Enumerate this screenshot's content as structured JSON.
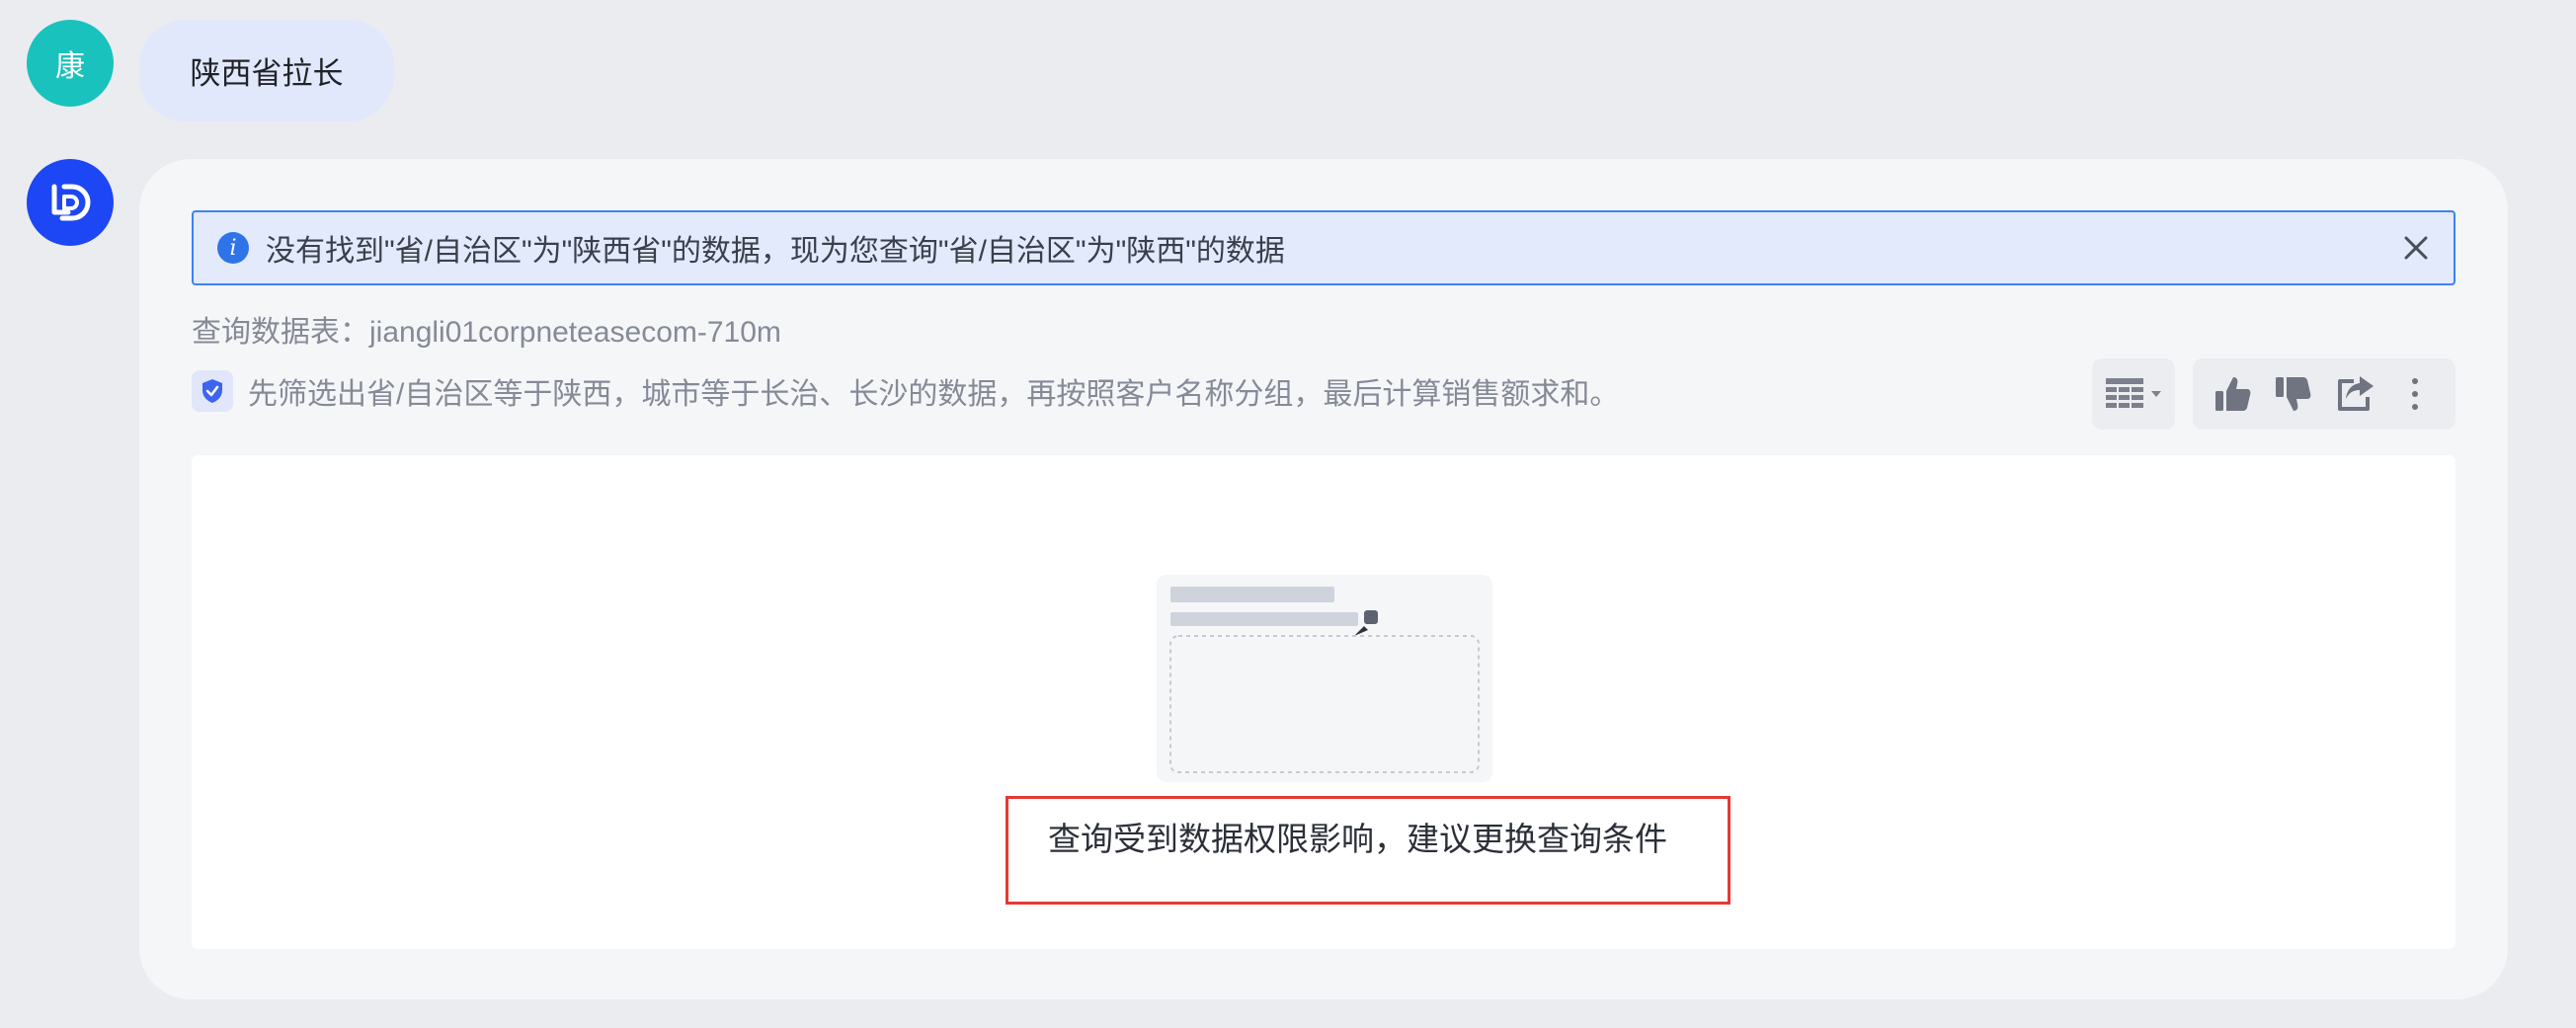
{
  "user": {
    "avatar_text": "康",
    "message": "陕西省拉长"
  },
  "bot": {
    "avatar_icon": "bot-logo-icon"
  },
  "answer": {
    "notice": {
      "icon": "info-icon",
      "text": "没有找到\"省/自治区\"为\"陕西省\"的数据，现为您查询\"省/自治区\"为\"陕西\"的数据",
      "close_icon": "close-icon"
    },
    "query_table": "查询数据表：jiangli01corpneteasecom-710m",
    "summary": {
      "icon": "shield-check-icon",
      "text": "先筛选出省/自治区等于陕西，城市等于长治、长沙的数据，再按照客户名称分组，最后计算销售额求和。"
    },
    "toolbar": {
      "view_switch_icon": "table-icon",
      "actions": [
        "thumbs-up-icon",
        "thumbs-down-icon",
        "share-icon",
        "more-icon"
      ]
    },
    "result": {
      "empty_message": "查询受到数据权限影响，建议更换查询条件"
    }
  },
  "colors": {
    "page_bg": "#ebecf0",
    "user_avatar": "#19c2bd",
    "bot_avatar": "#1d46f5",
    "notice_border": "#3b82f6",
    "highlight_box": "#e53935"
  }
}
